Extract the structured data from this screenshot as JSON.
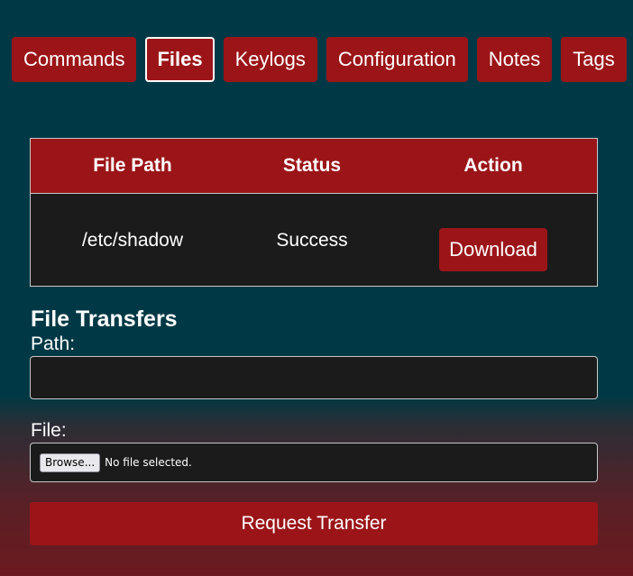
{
  "tabs": [
    {
      "label": "Commands",
      "active": false
    },
    {
      "label": "Files",
      "active": true
    },
    {
      "label": "Keylogs",
      "active": false
    },
    {
      "label": "Configuration",
      "active": false
    },
    {
      "label": "Notes",
      "active": false
    },
    {
      "label": "Tags",
      "active": false
    }
  ],
  "table": {
    "headers": [
      "File Path",
      "Status",
      "Action"
    ],
    "rows": [
      {
        "file_path": "/etc/shadow",
        "status": "Success",
        "action_label": "Download"
      }
    ]
  },
  "form": {
    "title": "File Transfers",
    "path_label": "Path:",
    "path_value": "",
    "file_label": "File:",
    "browse_label": "Browse...",
    "no_file_text": "No file selected.",
    "submit_label": "Request Transfer"
  },
  "colors": {
    "background": "#003945",
    "accent": "#9b1518",
    "panel": "#1b1b1b",
    "text": "#ffffff"
  }
}
